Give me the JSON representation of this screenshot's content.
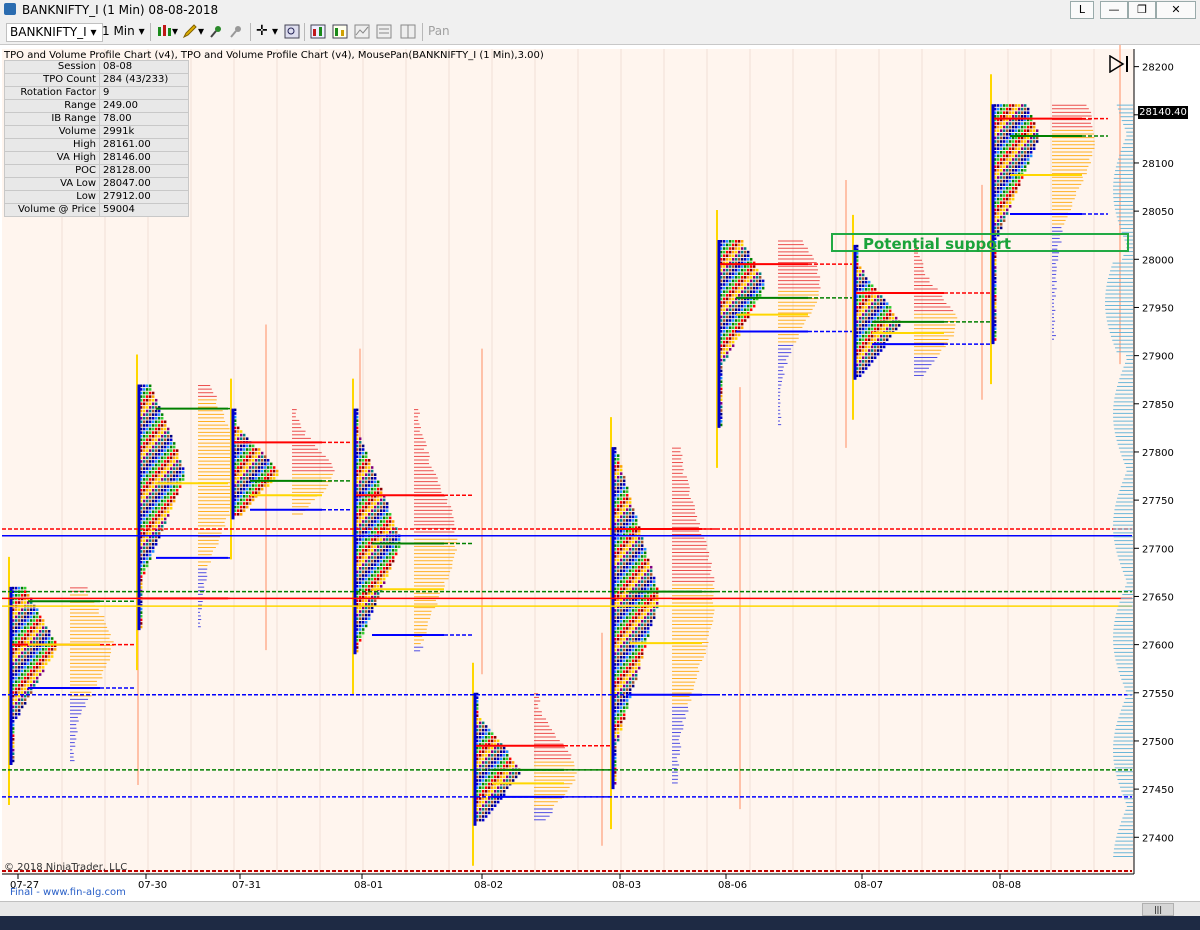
{
  "window": {
    "title": "BANKNIFTY_I (1 Min)  08-08-2018",
    "btn_l": "L"
  },
  "toolbar": {
    "instrument": "BANKNIFTY_I",
    "interval": "1 Min",
    "pan": "Pan"
  },
  "chart_subtitle": "TPO and Volume Profile Chart (v4),  TPO and Volume Profile Chart (v4), MousePan(BANKNIFTY_I (1 Min),3.00)",
  "info_rows": [
    {
      "label": "Session",
      "value": "08-08"
    },
    {
      "label": "TPO Count",
      "value": "284 (43/233)"
    },
    {
      "label": "Rotation Factor",
      "value": "9"
    },
    {
      "label": "Range",
      "value": "249.00"
    },
    {
      "label": "IB Range",
      "value": "78.00"
    },
    {
      "label": "Volume",
      "value": "2991k"
    },
    {
      "label": "High",
      "value": "28161.00"
    },
    {
      "label": "VA High",
      "value": "28146.00"
    },
    {
      "label": "POC",
      "value": "28128.00"
    },
    {
      "label": "VA Low",
      "value": "28047.00"
    },
    {
      "label": "Low",
      "value": "27912.00"
    },
    {
      "label": "Volume @ Price",
      "value": "59004"
    }
  ],
  "annotation": "Potential support",
  "last_price": "28140.40",
  "copyright": "© 2018 NinjaTrader, LLC",
  "footer": "Final - www.fin-alg.com",
  "colors": {
    "background": "#fff5ee",
    "poc": "#ff0000",
    "va_high": "#008000",
    "va_low": "#0000ff",
    "ib": "#ffd700",
    "annotation": "#22aa44"
  },
  "chart_data": {
    "type": "market-profile",
    "y_ticks": [
      28200,
      28150,
      28100,
      28050,
      28000,
      27950,
      27900,
      27850,
      27800,
      27750,
      27700,
      27650,
      27600,
      27550,
      27500,
      27450,
      27400
    ],
    "ylim": [
      27365,
      28210
    ],
    "x_labels": [
      {
        "label": "07-27",
        "idx": 0
      },
      {
        "label": "07-30",
        "idx": 1
      },
      {
        "label": "07-31",
        "idx": 2
      },
      {
        "label": "08-01",
        "idx": 3
      },
      {
        "label": "08-02",
        "idx": 4
      },
      {
        "label": "08-03",
        "idx": 5
      },
      {
        "label": "08-06",
        "idx": 6
      },
      {
        "label": "08-07",
        "idx": 7
      },
      {
        "label": "08-08",
        "idx": 8
      }
    ],
    "sessions": [
      {
        "date": "07-27",
        "high": 27660,
        "low": 27475,
        "poc": 27600,
        "vah": 27645,
        "val": 27555,
        "tpo_peak": 27600
      },
      {
        "date": "07-30",
        "high": 27870,
        "low": 27615,
        "poc": 27648,
        "vah": 27845,
        "val": 27690,
        "tpo_peak": 27780
      },
      {
        "date": "07-31",
        "high": 27845,
        "low": 27730,
        "poc": 27810,
        "vah": 27770,
        "val": 27740,
        "tpo_peak": 27780
      },
      {
        "date": "08-01",
        "high": 27845,
        "low": 27590,
        "poc": 27755,
        "vah": 27705,
        "val": 27610,
        "tpo_peak": 27710
      },
      {
        "date": "08-02",
        "high": 27550,
        "low": 27412,
        "poc": 27495,
        "vah": 27470,
        "val": 27442,
        "tpo_peak": 27470
      },
      {
        "date": "08-03",
        "high": 27805,
        "low": 27450,
        "poc": 27720,
        "vah": 27655,
        "val": 27548,
        "tpo_peak": 27650
      },
      {
        "date": "08-06",
        "high": 28020,
        "low": 27825,
        "poc": 27995,
        "vah": 27960,
        "val": 27925,
        "tpo_peak": 27975
      },
      {
        "date": "08-07",
        "high": 28015,
        "low": 27875,
        "poc": 27965,
        "vah": 27935,
        "val": 27912,
        "tpo_peak": 27935
      },
      {
        "date": "08-08",
        "high": 28161,
        "low": 27912,
        "poc": 28146,
        "vah": 28128,
        "val": 28047,
        "tpo_peak": 28128
      }
    ]
  }
}
